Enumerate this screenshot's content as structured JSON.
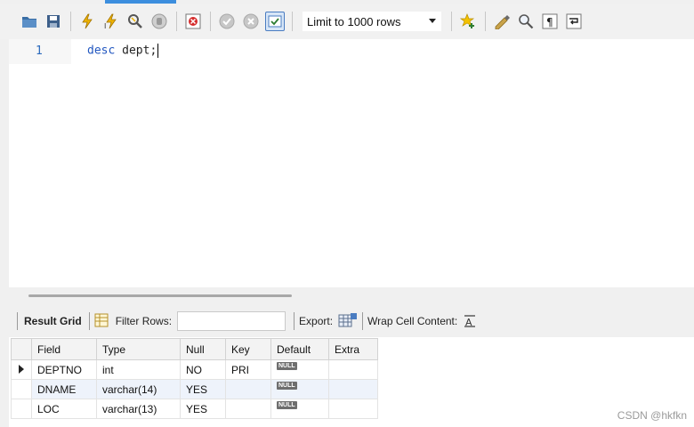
{
  "toolbar": {
    "limit_select_value": "Limit to 1000 rows",
    "icons": [
      "open-folder-icon",
      "save-icon",
      "execute-icon",
      "execute-current-icon",
      "explain-icon",
      "stop-icon",
      "toggle-error-icon",
      "commit-icon",
      "rollback-icon",
      "autocommit-icon",
      "add-bookmark-icon",
      "beautify-icon",
      "find-icon",
      "invisible-chars-icon",
      "wrap-icon"
    ]
  },
  "editor": {
    "line_number": "1",
    "keyword": "desc",
    "rest": " dept;"
  },
  "result_toolbar": {
    "result_grid_label": "Result Grid",
    "filter_label": "Filter Rows:",
    "filter_value": "",
    "export_label": "Export:",
    "wrap_label": "Wrap Cell Content:"
  },
  "grid": {
    "columns": [
      "Field",
      "Type",
      "Null",
      "Key",
      "Default",
      "Extra"
    ],
    "rows": [
      {
        "field": "DEPTNO",
        "type": "int",
        "null": "NO",
        "key": "PRI",
        "default": "NULL",
        "extra": ""
      },
      {
        "field": "DNAME",
        "type": "varchar(14)",
        "null": "YES",
        "key": "",
        "default": "NULL",
        "extra": ""
      },
      {
        "field": "LOC",
        "type": "varchar(13)",
        "null": "YES",
        "key": "",
        "default": "NULL",
        "extra": ""
      }
    ]
  },
  "watermark": "CSDN @hkfkn",
  "colors": {
    "accent": "#3c8ede",
    "keyword": "#2257c0",
    "row_alt": "#eef3fb"
  }
}
